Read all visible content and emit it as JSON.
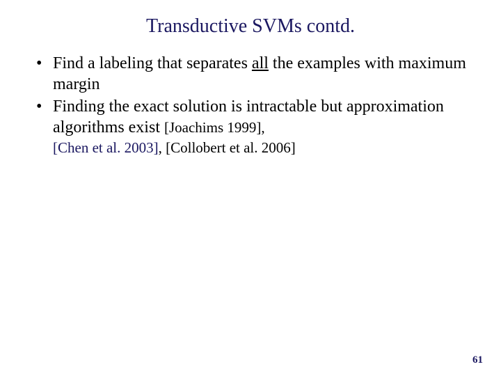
{
  "title": "Transductive SVMs contd.",
  "bullet1_a": "Find a labeling that separates ",
  "bullet1_b": "all",
  "bullet1_c": " the examples with maximum margin",
  "bullet2_a": "Finding the exact solution is intractable but approximation algorithms exist ",
  "cite1": "[Joachims 1999]",
  "comma": ", ",
  "cite2": "[Chen et al. 2003]",
  "cite3": "[Collobert et al. 2006]",
  "pagenum": "61"
}
